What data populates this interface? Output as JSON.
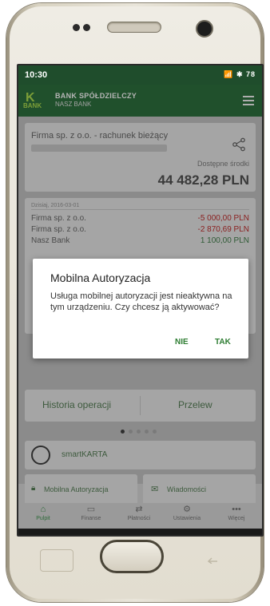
{
  "status": {
    "time": "10:30",
    "icons": "📶 ✱ 78"
  },
  "header": {
    "logo_mark": "K",
    "logo_text": "BANK",
    "title": "BANK SPÓŁDZIELCZY",
    "subtitle": "NASZ BANK"
  },
  "account": {
    "name": "Firma sp. z o.o. - rachunek bieżący",
    "available_label": "Dostępne środki",
    "balance": "44 482,28 PLN"
  },
  "transactions": {
    "date": "Dzisiaj, 2016-03-01",
    "items": [
      {
        "name": "Firma sp. z o.o.",
        "amount": "-5 000,00 PLN"
      },
      {
        "name": "Firma sp. z o.o.",
        "amount": "-2 870,69 PLN"
      },
      {
        "name": "Nasz Bank",
        "amount": "1 100,00 PLN"
      }
    ]
  },
  "tabs": {
    "history": "Historia operacji",
    "transfer": "Przelew"
  },
  "smartkarta": {
    "label": "smartKARTA"
  },
  "quick": {
    "auth": "Mobilna Autoryzacja",
    "messages": "Wiadomości"
  },
  "bottomnav": [
    {
      "label": "Pulpit",
      "icon": "home-icon"
    },
    {
      "label": "Finanse",
      "icon": "wallet-icon"
    },
    {
      "label": "Płatności",
      "icon": "transfer-icon"
    },
    {
      "label": "Ustawienia",
      "icon": "gear-icon"
    },
    {
      "label": "Więcej",
      "icon": "more-icon"
    }
  ],
  "dialog": {
    "title": "Mobilna Autoryzacja",
    "body": "Usługa mobilnej autoryzacji jest nieaktywna na tym urządzeniu. Czy chcesz ją aktywować?",
    "no": "NIE",
    "yes": "TAK"
  },
  "colors": {
    "accent": "#2e7d32",
    "header": "#2a6a3a",
    "negative": "#8a2020"
  }
}
